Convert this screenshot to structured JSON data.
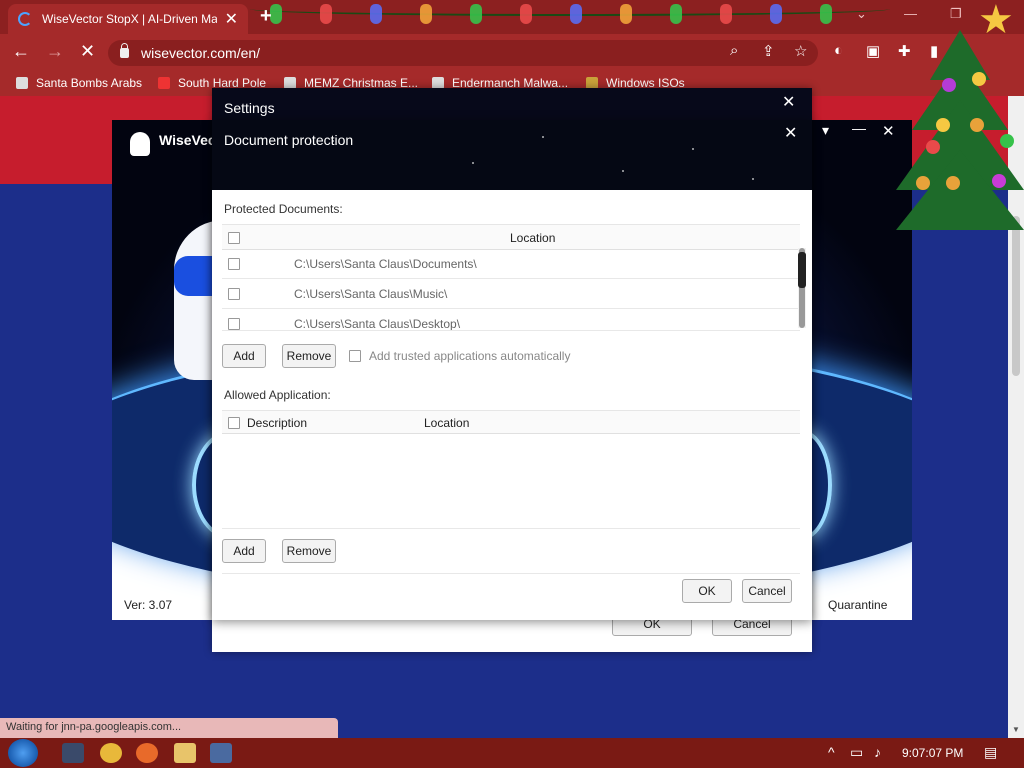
{
  "browser": {
    "tab_title": "WiseVector StopX | AI-Driven Ma",
    "tab_close": "✕",
    "new_tab": "+",
    "url": "wisevector.com/en/",
    "bookmarks": [
      {
        "label": "Santa Bombs Arabs"
      },
      {
        "label": "South Hard Pole"
      },
      {
        "label": "MEMZ Christmas E..."
      },
      {
        "label": "Endermanch Malwa..."
      },
      {
        "label": "Windows ISOs"
      }
    ],
    "status": "Waiting for jnn-pa.googleapis.com..."
  },
  "app": {
    "title": "WiseVector",
    "version": "Ver: 3.07",
    "quarantine": "Quarantine"
  },
  "settings_dialog": {
    "title": "Settings",
    "close": "✕",
    "ok": "OK",
    "cancel": "Cancel"
  },
  "doc_dialog": {
    "title": "Document protection",
    "close": "✕",
    "minimize": "—",
    "menu": "▾",
    "protected_label": "Protected Documents:",
    "protected_header_location": "Location",
    "protected_rows": [
      {
        "path": "C:\\Users\\Santa Claus\\Documents\\"
      },
      {
        "path": "C:\\Users\\Santa Claus\\Music\\"
      },
      {
        "path": "C:\\Users\\Santa Claus\\Desktop\\"
      }
    ],
    "add_1": "Add",
    "remove_1": "Remove",
    "trusted_option": "Add trusted applications automatically",
    "allowed_label": "Allowed Application:",
    "allowed_header_description": "Description",
    "allowed_header_location": "Location",
    "add_2": "Add",
    "remove_2": "Remove",
    "ok": "OK",
    "cancel": "Cancel"
  },
  "taskbar": {
    "clock": "9:07:07 PM"
  },
  "colors": {
    "browser_red": "#a52a2a",
    "page_blue": "#1c2e8a",
    "taskbar": "#7a1a14"
  }
}
